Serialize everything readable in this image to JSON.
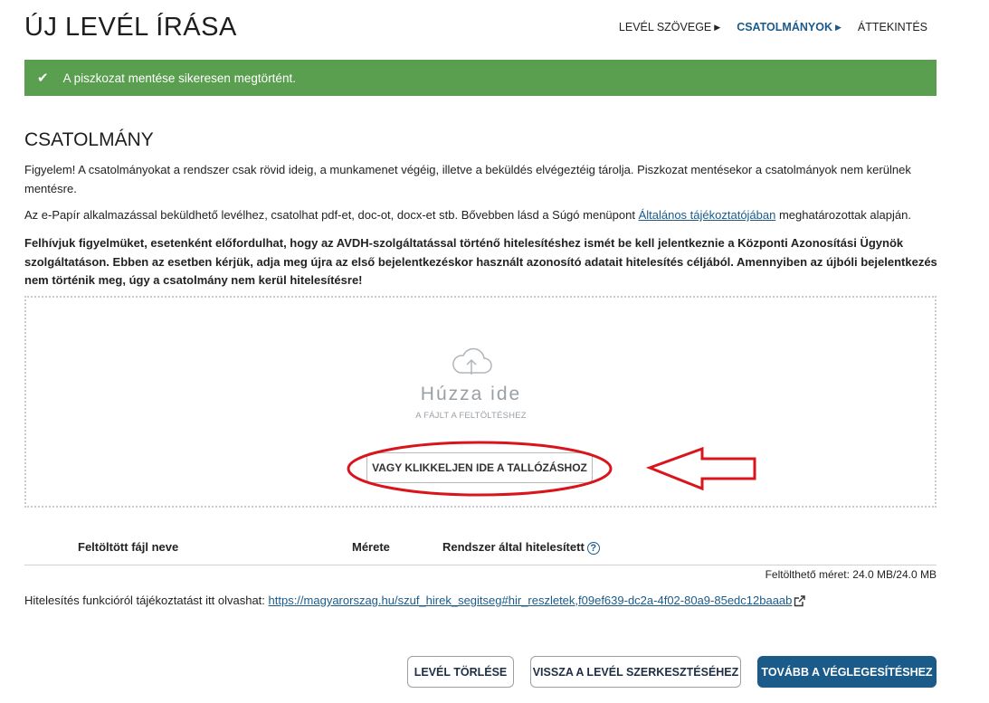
{
  "page": {
    "title": "ÚJ LEVÉL ÍRÁSA"
  },
  "steps": [
    {
      "label": "LEVÉL SZÖVEGE",
      "active": false,
      "arrow": "▶"
    },
    {
      "label": "CSATOLMÁNYOK",
      "active": true,
      "arrow": "▶"
    },
    {
      "label": "ÁTTEKINTÉS",
      "active": false
    }
  ],
  "alert": {
    "text": "A piszkozat mentése sikeresen megtörtént.",
    "icon": "check-icon",
    "color": "#5a9e4f"
  },
  "section": {
    "title": "CSATOLMÁNY"
  },
  "paragraphs": {
    "p1": "Figyelem! A csatolmányokat a rendszer csak rövid ideig, a munkamenet végéig, illetve a beküldés elvégeztéig tárolja. Piszkozat mentésekor a csatolmányok nem kerülnek mentésre.",
    "p2_before": "Az e-Papír alkalmazással beküldhető levélhez, csatolhat pdf-et, doc-ot, docx-et stb. Bővebben lásd a Súgó menüpont ",
    "p2_link": "Általános tájékoztatójában",
    "p2_after": " meghatározottak alapján.",
    "p3": "Felhívjuk figyelmüket, esetenként előfordulhat, hogy az AVDH-szolgáltatással történő hitelesítéshez ismét be kell jelentkeznie a Központi Azonosítási Ügynök szolgáltatáson. Ebben az esetben kérjük, adja meg újra az első bejelentkezéskor használt azonosító adatait hitelesítés céljából. Amennyiben az újbóli bejelentkezés nem történik meg, úgy a csatolmány nem kerül hitelesítésre!"
  },
  "dropzone": {
    "icon": "cloud-upload-icon",
    "main": "Húzza ide",
    "sub": "A FÁJLT A FELTÖLTÉSHEZ",
    "browse_label": "VAGY KLIKKELJEN IDE A TALLÓZÁSHOZ"
  },
  "annotation": {
    "color": "#d9141b"
  },
  "table": {
    "headers": [
      "Feltöltött fájl neve",
      "Mérete",
      "Rendszer által hitelesített"
    ],
    "help_icon": "?"
  },
  "upload_size": "Feltölthető méret: 24.0 MB/24.0 MB",
  "verify": {
    "text": "Hitelesítés funkcióról tájékoztatást itt olvashat: ",
    "link": "https://magyarorszag.hu/szuf_hirek_segitseg#hir_reszletek,f09ef639-dc2a-4f02-80a9-85edc12baaab"
  },
  "buttons": {
    "delete": "LEVÉL TÖRLÉSE",
    "back": "VISSZA A LEVÉL SZERKESZTÉSÉHEZ",
    "next": "TOVÁBB A VÉGLEGESÍTÉSHEZ"
  },
  "colors": {
    "accent": "#1b5b8a",
    "success": "#5a9e4f"
  }
}
